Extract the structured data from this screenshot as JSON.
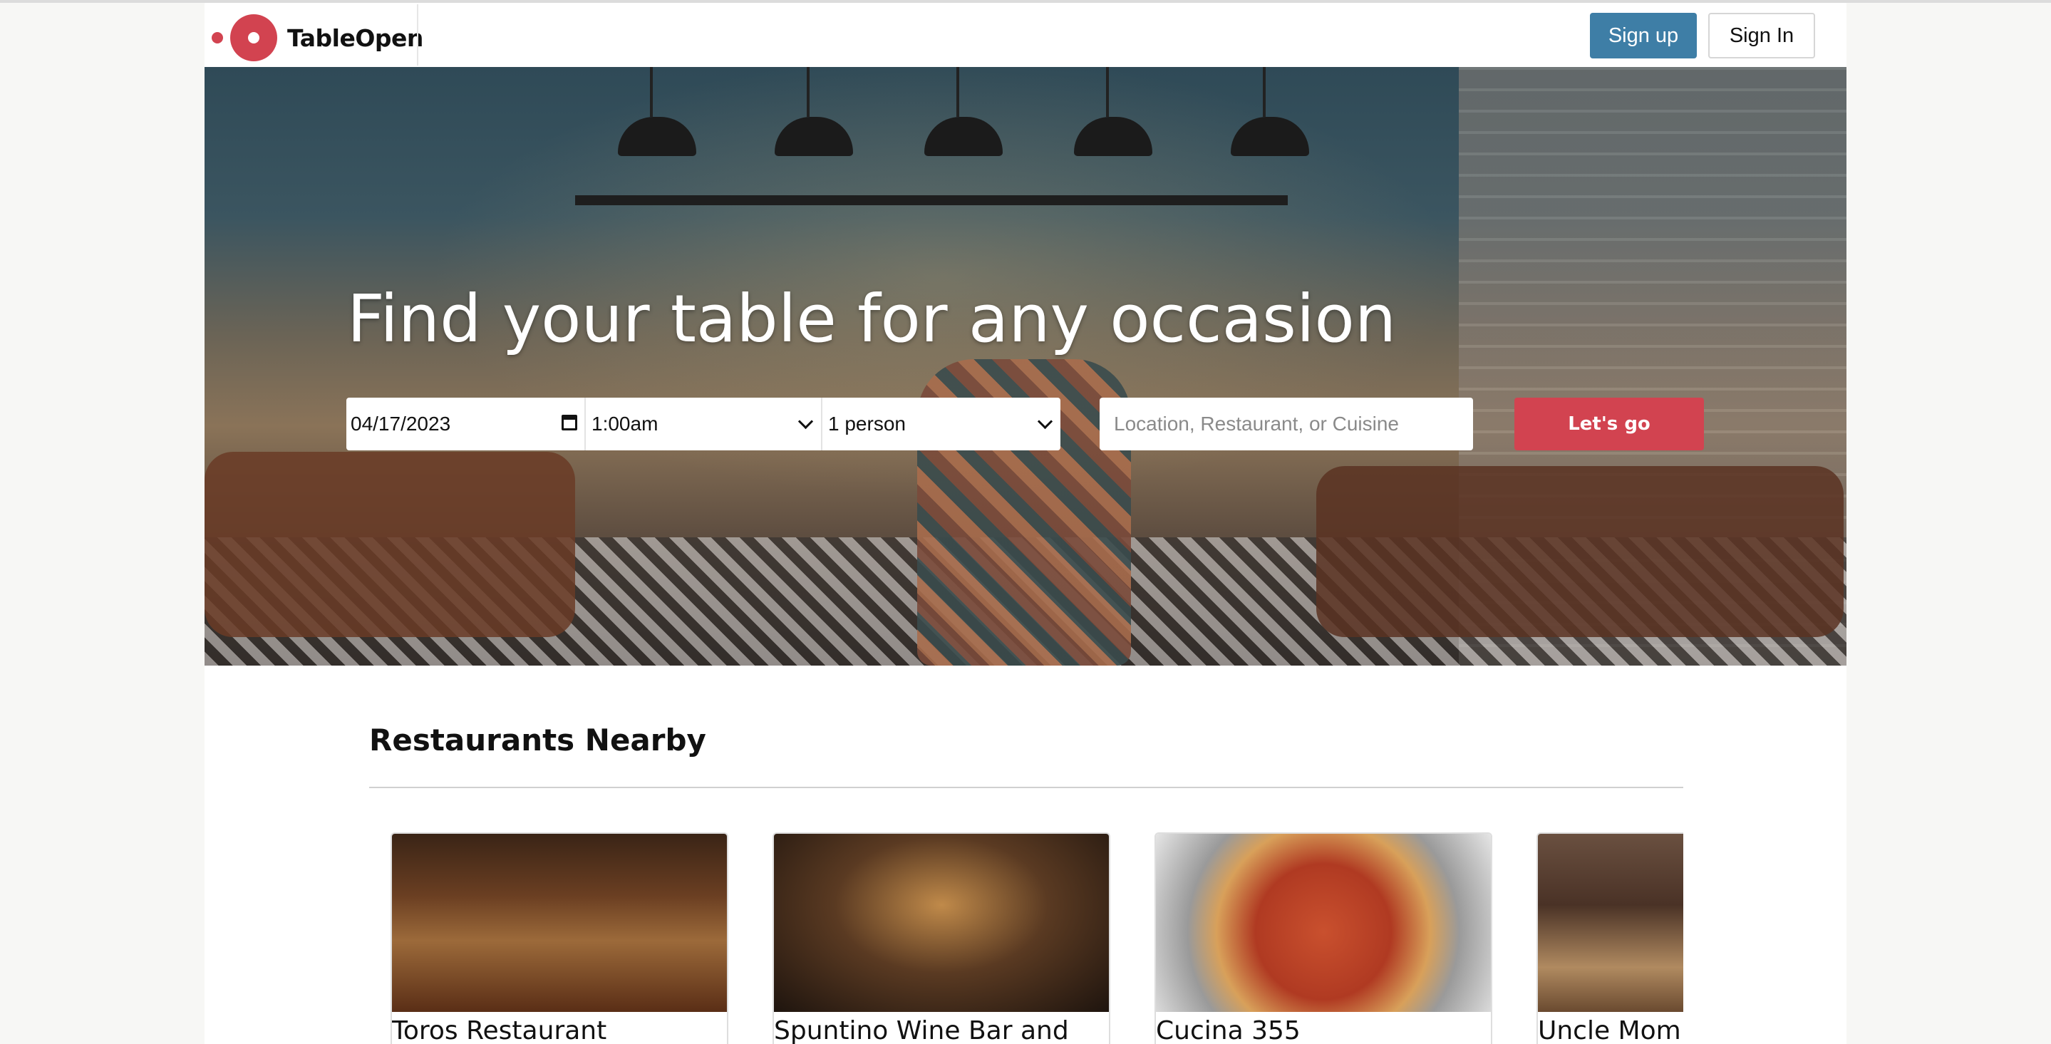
{
  "header": {
    "brand": "TableOpen",
    "signup_label": "Sign up",
    "signin_label": "Sign In",
    "colors": {
      "brand_red": "#d24350",
      "signup_blue": "#3e7ea6"
    }
  },
  "hero": {
    "title": "Find your table for any occasion",
    "date_value": "04/17/2023",
    "time_value": "1:00am",
    "party_value": "1 person",
    "search_placeholder": "Location, Restaurant, or Cuisine",
    "go_label": "Let's go",
    "icons": [
      "calendar-icon",
      "chevron-down-icon"
    ]
  },
  "nearby": {
    "title": "Restaurants Nearby",
    "restaurants": [
      {
        "name": "Toros Restaurant"
      },
      {
        "name": "Spuntino Wine Bar and"
      },
      {
        "name": "Cucina 355"
      },
      {
        "name": "Uncle Mom"
      }
    ]
  }
}
